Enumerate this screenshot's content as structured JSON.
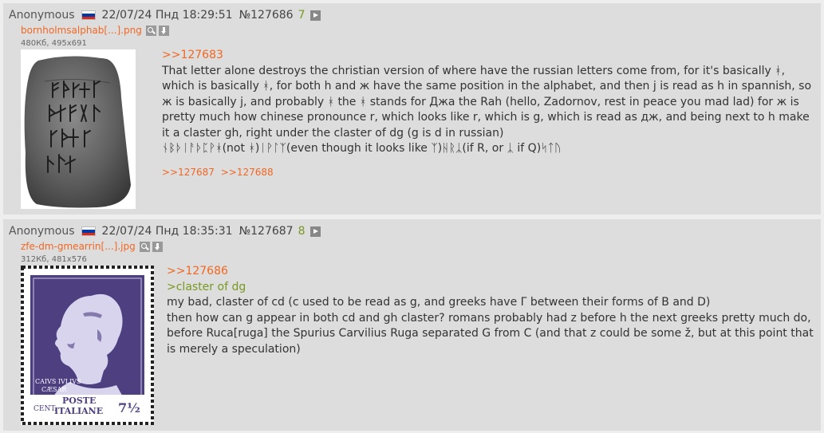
{
  "posts": [
    {
      "name": "Anonymous",
      "date": "22/07/24 Пнд 18:29:51",
      "number": "№127686",
      "reply_count": "7",
      "file": {
        "name": "bornholmsalphab[...].png",
        "meta": "480Кб, 495x691"
      },
      "reply_to": ">>127683",
      "text_lines": [
        "That letter alone destroys the christian version of where have the russian letters come from, for it's basically ᚼ, which is basically ᚼ, for both h and ж have the same position in the alphabet, and then j is read as h in spannish, so ж is basically j, and probably ᚼ the ᚼ stands for Джа the Rah (hello, Zadornov, rest in peace you mad lad) for ж is pretty much how chinese pronounce r, which looks like r, which is g, which is read as дж, and being next to h make it a claster gh, right under the claster of dg (g is d in russian)",
        "ᚾᛒᚦᛁᚨᚦᛈᚹᚼ(not ᚼ)ᛁᚹᛚᛉ(even though it looks like ᛉ)ᚺᚱᛣ(if R, or ᛣ if Q)ᛋᛏᚢ"
      ],
      "backlinks": [
        ">>127687",
        ">>127688"
      ]
    },
    {
      "name": "Anonymous",
      "date": "22/07/24 Пнд 18:35:31",
      "number": "№127687",
      "reply_count": "8",
      "file": {
        "name": "zfe-dm-gmearrin[...].jpg",
        "meta": "312Кб, 481x576"
      },
      "reply_to": ">>127686",
      "greentext": ">claster of dg",
      "text_lines": [
        "my bad, claster of cd (c used to be read as g, and greeks have Γ between their forms of B and D)",
        "then how can g appear in both cd and gh claster? romans probably had z before h the next greeks pretty much do, before Ruca[ruga] the Spurius Carvilius Ruga separated G from C (and that z could be some ž, but at this point that is merely a speculation)"
      ],
      "stamp_text": {
        "caption_1": "CAIVS IVLIVS",
        "caption_2": "CÆSAR",
        "denomination_prefix": "CENT.",
        "poste": "POSTE",
        "italiane": "ITALIANE",
        "value": "7½"
      }
    }
  ],
  "colors": {
    "page_bg": "#eeeeee",
    "post_bg": "#dddddd",
    "link": "#f26722",
    "greentext": "#789922",
    "stamp_purple": "#4d3f80"
  },
  "icons": {
    "flag": "russia-flag-icon",
    "play": "play-icon",
    "search": "image-search-icon",
    "download": "download-icon"
  }
}
